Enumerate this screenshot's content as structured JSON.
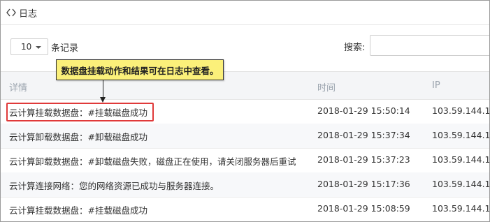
{
  "panel": {
    "title": "日志",
    "icon": "code-brackets-icon"
  },
  "controls": {
    "page_length": "10",
    "page_length_suffix": "条记录",
    "search_label": "搜索:",
    "search_value": ""
  },
  "table": {
    "headers": {
      "detail": "详情",
      "time": "时间",
      "ip": "IP"
    },
    "rows": [
      {
        "detail": "云计算挂载数据盘：#挂载磁盘成功",
        "time": "2018-01-29 15:50:14",
        "ip": "103.59.144.1"
      },
      {
        "detail": "云计算卸载数据盘：#卸载磁盘成功",
        "time": "2018-01-29 15:37:34",
        "ip": "103.59.144.1"
      },
      {
        "detail": "云计算卸载数据盘：#卸载磁盘失败，磁盘正在使用，请关闭服务器后重试",
        "time": "2018-01-29 15:37:23",
        "ip": "103.59.144.1"
      },
      {
        "detail": "云计算连接网络：您的网络资源已成功与服务器连接。",
        "time": "2018-01-29 15:17:36",
        "ip": "103.59.144.1"
      },
      {
        "detail": "云计算挂载数据盘：#挂载磁盘成功",
        "time": "2018-01-29 15:08:59",
        "ip": "103.59.144.1"
      }
    ]
  },
  "annotation": {
    "callout_text": "数据盘挂载动作和结果可在日志中查看。",
    "highlight_color": "#e03a3a",
    "callout_color": "#fbf07a"
  }
}
